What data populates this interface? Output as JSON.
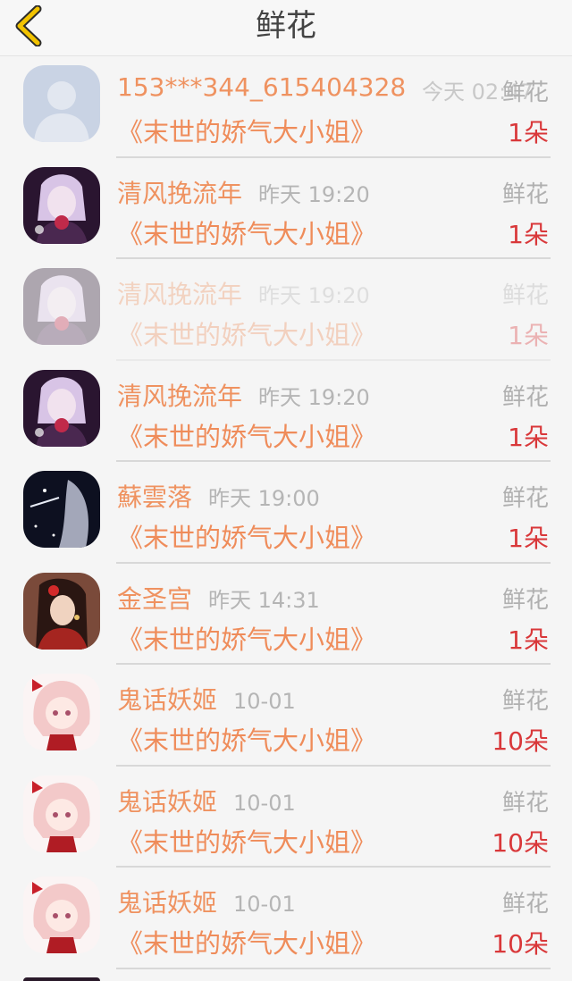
{
  "header": {
    "title": "鲜花",
    "back_icon": "chevron-left-icon",
    "accent": "#f2c300"
  },
  "rows": [
    {
      "name": "153***344_615404328",
      "time": "今天 02:47",
      "type": "鲜花",
      "book": "《末世的娇气大小姐》",
      "count": "1朵",
      "avatar": "default-avatar"
    },
    {
      "name": "清风挽流年",
      "time": "昨天 19:20",
      "type": "鲜花",
      "book": "《末世的娇气大小姐》",
      "count": "1朵",
      "avatar": "anime-avatar"
    },
    {
      "name": "清风挽流年",
      "time": "昨天 19:20",
      "type": "鲜花",
      "book": "《末世的娇气大小姐》",
      "count": "1朵",
      "avatar": "anime-avatar"
    },
    {
      "name": "清风挽流年",
      "time": "昨天 19:20",
      "type": "鲜花",
      "book": "《末世的娇气大小姐》",
      "count": "1朵",
      "avatar": "anime-avatar"
    },
    {
      "name": "蘇雲落",
      "time": "昨天 19:00",
      "type": "鲜花",
      "book": "《末世的娇气大小姐》",
      "count": "1朵",
      "avatar": "dark-avatar"
    },
    {
      "name": "金圣宫",
      "time": "昨天 14:31",
      "type": "鲜花",
      "book": "《末世的娇气大小姐》",
      "count": "1朵",
      "avatar": "portrait-avatar"
    },
    {
      "name": "鬼话妖姬",
      "time": "10-01",
      "type": "鲜花",
      "book": "《末世的娇气大小姐》",
      "count": "10朵",
      "avatar": "chibi-avatar"
    },
    {
      "name": "鬼话妖姬",
      "time": "10-01",
      "type": "鲜花",
      "book": "《末世的娇气大小姐》",
      "count": "10朵",
      "avatar": "chibi-avatar"
    },
    {
      "name": "鬼话妖姬",
      "time": "10-01",
      "type": "鲜花",
      "book": "《末世的娇气大小姐》",
      "count": "10朵",
      "avatar": "chibi-avatar"
    }
  ],
  "colors": {
    "name": "#ef9260",
    "book": "#ef8c5a",
    "count": "#d9383a",
    "muted": "#b0b0b0"
  }
}
